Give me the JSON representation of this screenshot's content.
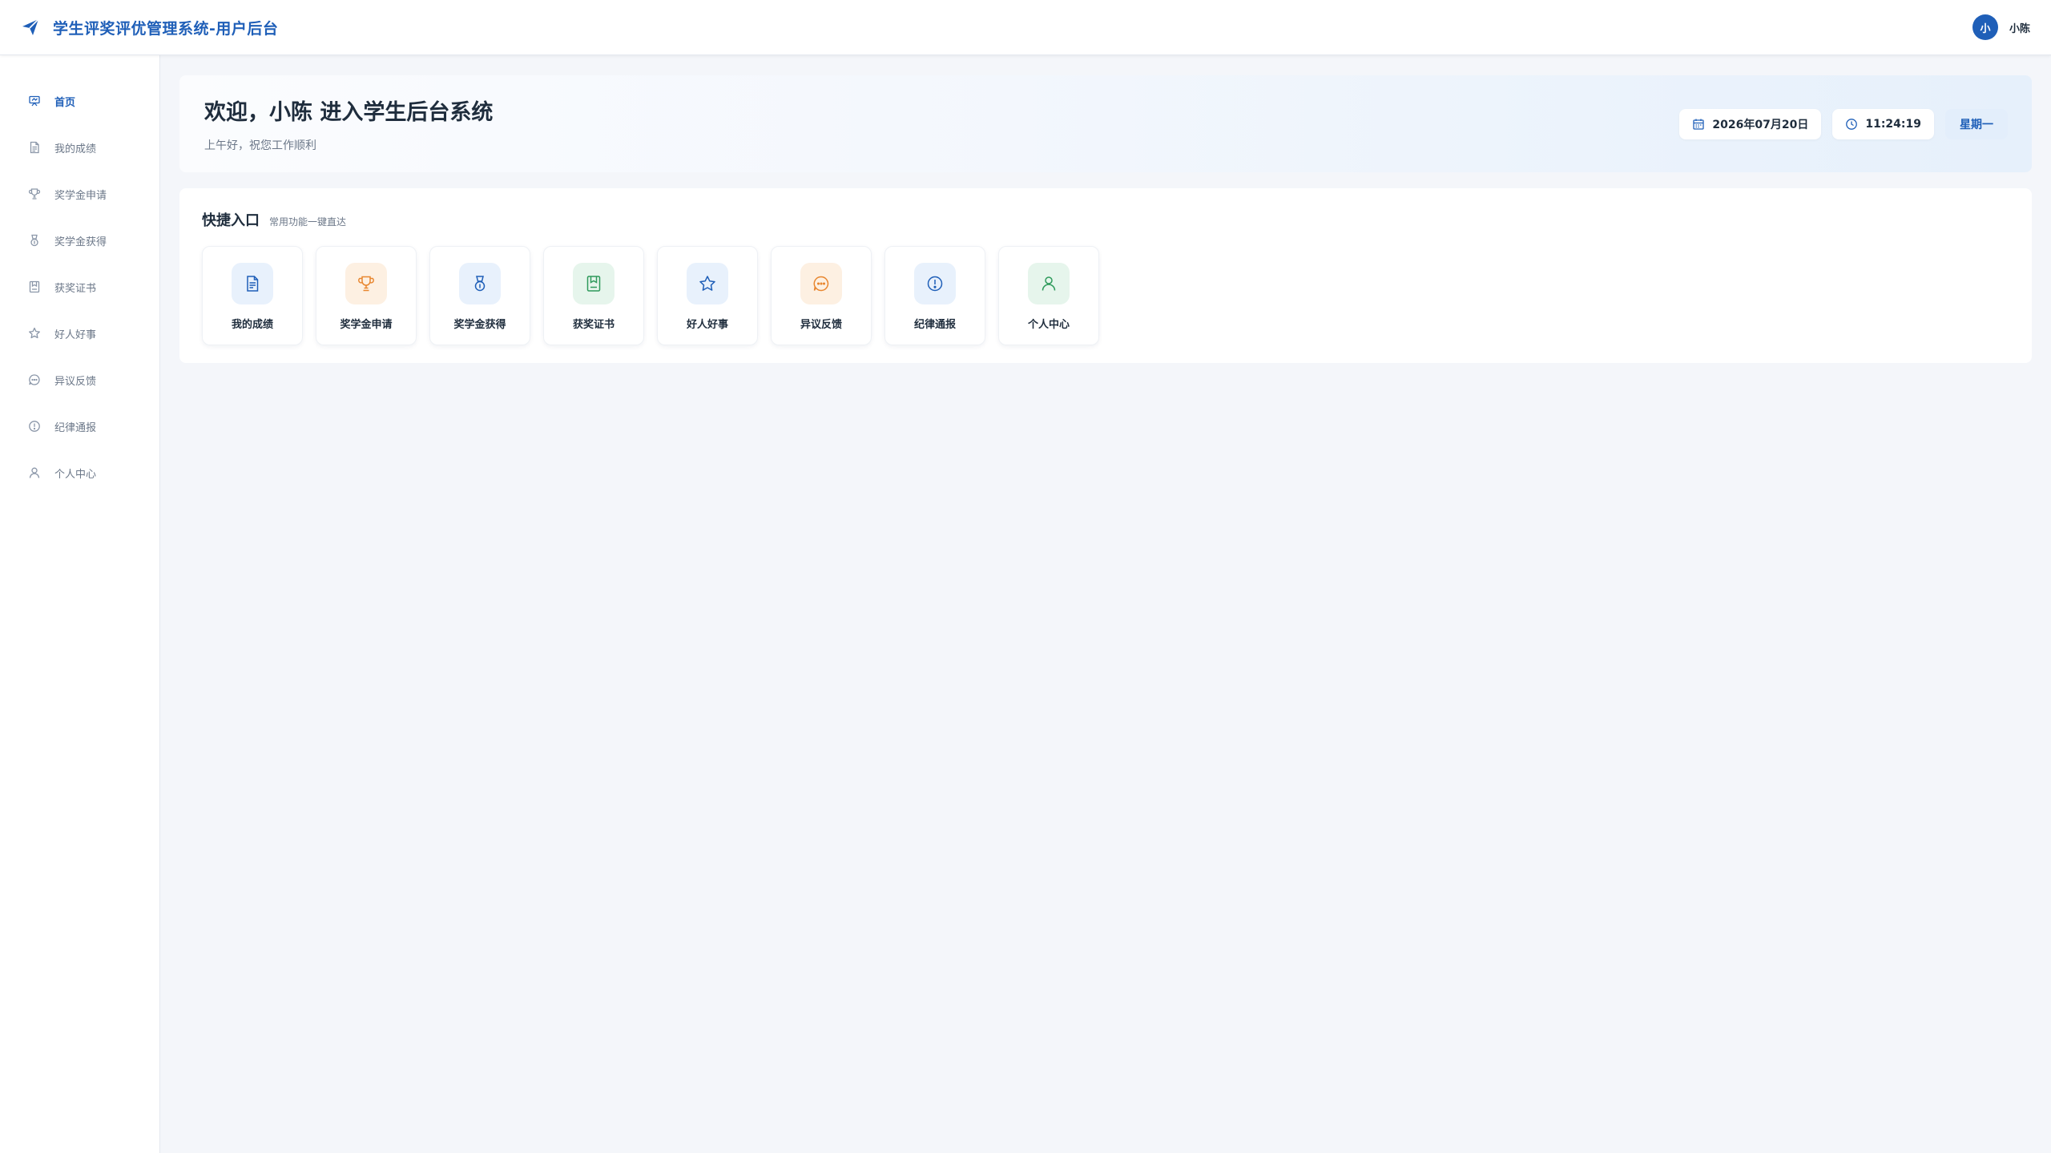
{
  "header": {
    "title": "学生评奖评优管理系统-用户后台",
    "brand_icon": "paper-plane-icon",
    "user": {
      "avatar_text": "小",
      "name": "小陈"
    }
  },
  "sidebar": {
    "items": [
      {
        "label": "首页",
        "icon": "home-icon",
        "active": true
      },
      {
        "label": "我的成绩",
        "icon": "document-icon",
        "active": false
      },
      {
        "label": "奖学金申请",
        "icon": "trophy-icon",
        "active": false
      },
      {
        "label": "奖学金获得",
        "icon": "medal-icon",
        "active": false
      },
      {
        "label": "获奖证书",
        "icon": "certificate-icon",
        "active": false
      },
      {
        "label": "好人好事",
        "icon": "star-icon",
        "active": false
      },
      {
        "label": "异议反馈",
        "icon": "chat-icon",
        "active": false
      },
      {
        "label": "纪律通报",
        "icon": "alert-icon",
        "active": false
      },
      {
        "label": "个人中心",
        "icon": "user-icon",
        "active": false
      }
    ]
  },
  "welcome": {
    "title": "欢迎，小陈 进入学生后台系统",
    "subtitle": "上午好，祝您工作顺利",
    "date": "2026年07月20日",
    "time": "11:24:19",
    "weekday": "星期一"
  },
  "quick": {
    "title": "快捷入口",
    "subtitle": "常用功能一键直达",
    "cards": [
      {
        "label": "我的成绩",
        "icon": "document-icon",
        "tint": "blue"
      },
      {
        "label": "奖学金申请",
        "icon": "trophy-icon",
        "tint": "orange"
      },
      {
        "label": "奖学金获得",
        "icon": "medal-icon",
        "tint": "blue"
      },
      {
        "label": "获奖证书",
        "icon": "certificate-icon",
        "tint": "green"
      },
      {
        "label": "好人好事",
        "icon": "star-icon",
        "tint": "blue"
      },
      {
        "label": "异议反馈",
        "icon": "chat-icon",
        "tint": "orange"
      },
      {
        "label": "纪律通报",
        "icon": "alert-icon",
        "tint": "blue"
      },
      {
        "label": "个人中心",
        "icon": "user-icon",
        "tint": "green"
      }
    ]
  },
  "colors": {
    "primary": "#1f5fb8",
    "sidebar_icon": "#8a96a8",
    "orange": "#e8862f",
    "green": "#2e9a5b",
    "page_bg": "#f4f6fa"
  }
}
